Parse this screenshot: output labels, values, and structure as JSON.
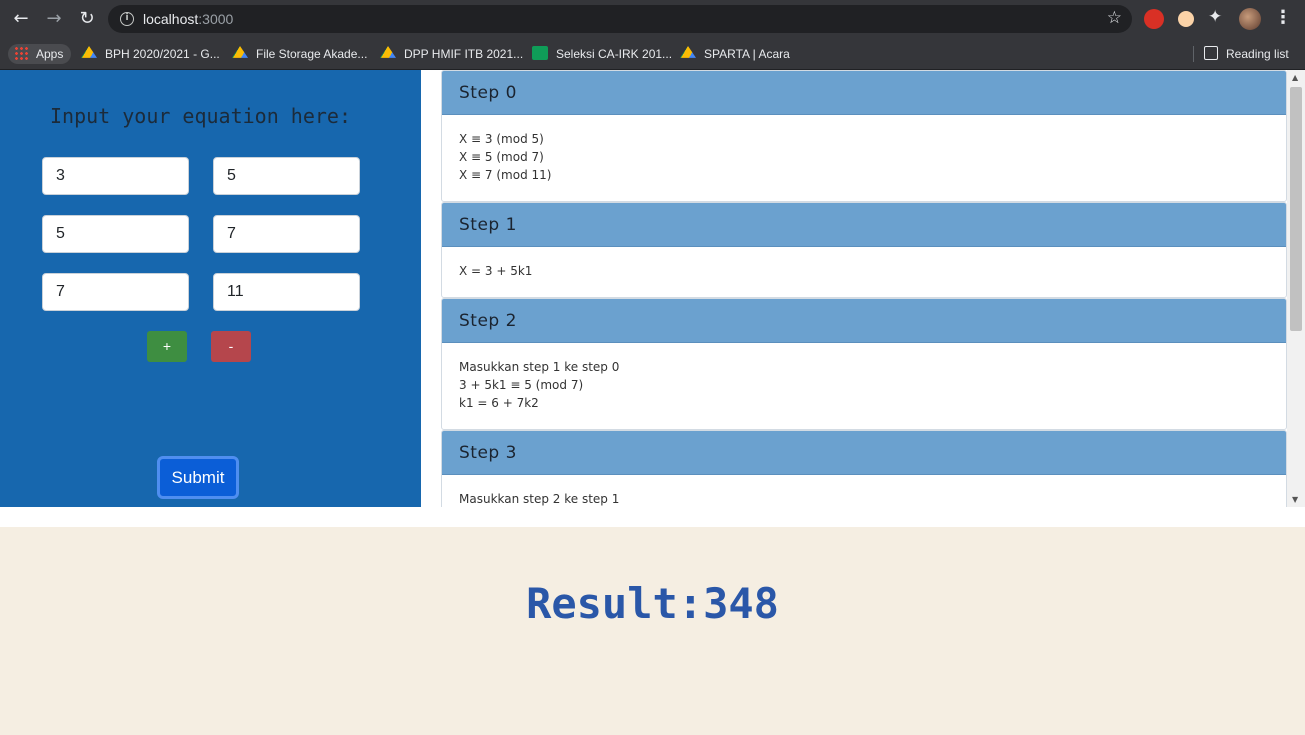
{
  "browser": {
    "url_host": "localhost",
    "url_port": ":3000",
    "bookmarks": [
      {
        "label": "Apps"
      },
      {
        "label": "BPH 2020/2021 - G..."
      },
      {
        "label": "File Storage Akade..."
      },
      {
        "label": "DPP HMIF ITB 2021..."
      },
      {
        "label": "Seleksi CA-IRK 201..."
      },
      {
        "label": "SPARTA | Acara"
      }
    ],
    "reading_list": "Reading list"
  },
  "form": {
    "title": "Input your equation here:",
    "rows": [
      {
        "a": "3",
        "b": "5"
      },
      {
        "a": "5",
        "b": "7"
      },
      {
        "a": "7",
        "b": "11"
      }
    ],
    "add_label": "+",
    "remove_label": "-",
    "submit_label": "Submit"
  },
  "steps": [
    {
      "title": "Step 0",
      "lines": [
        "X ≡ 3 (mod 5)",
        "X ≡ 5 (mod 7)",
        "X ≡ 7 (mod 11)"
      ]
    },
    {
      "title": "Step 1",
      "lines": [
        "X = 3 + 5k1"
      ]
    },
    {
      "title": "Step 2",
      "lines": [
        "Masukkan step 1 ke step 0",
        "3 + 5k1 ≡ 5 (mod 7)",
        "k1 = 6 + 7k2"
      ]
    },
    {
      "title": "Step 3",
      "lines": [
        "Masukkan step 2 ke step 1"
      ]
    }
  ],
  "result": {
    "text": "Result:348"
  }
}
